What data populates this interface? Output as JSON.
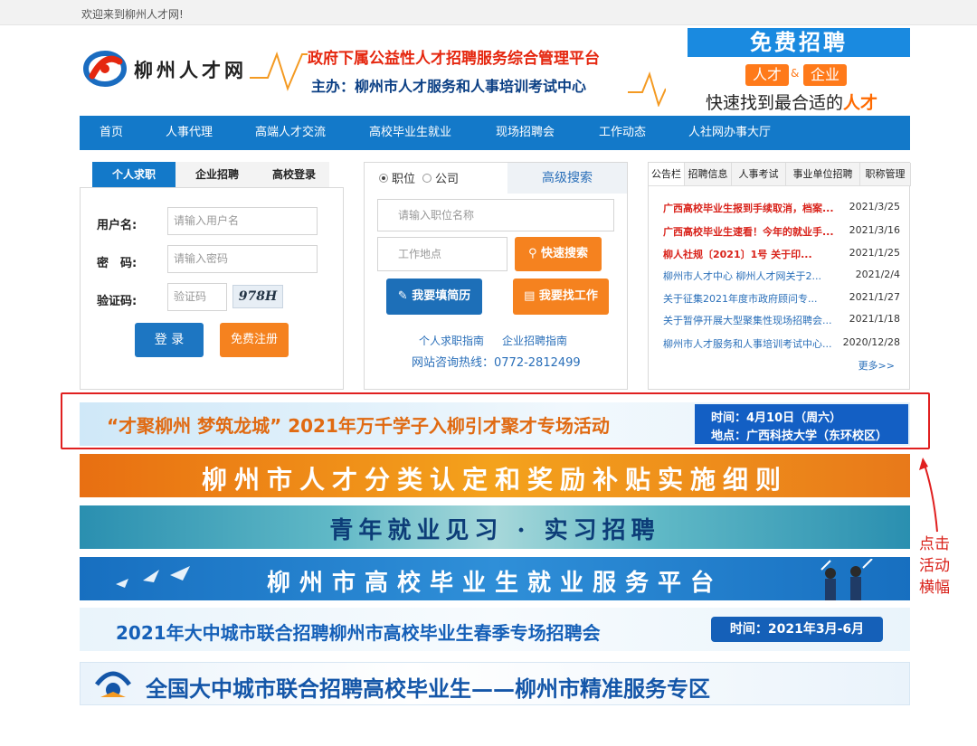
{
  "topbar": {
    "welcome": "欢迎来到柳州人才网!"
  },
  "header": {
    "logo_text": "柳州人才网",
    "slogan_line1": "政府下属公益性人才招聘服务综合管理平台",
    "slogan_line2": "主办：柳州市人才服务和人事培训考试中心",
    "promo_title": "免费招聘",
    "promo_talent": "人才",
    "promo_amp": "&",
    "promo_company": "企业",
    "promo_fast": "快速找到最合适的",
    "promo_fast_highlight": "人才"
  },
  "nav": [
    "首页",
    "人事代理",
    "高端人才交流",
    "高校毕业生就业",
    "现场招聘会",
    "工作动态",
    "人社网办事大厅"
  ],
  "login": {
    "tabs": [
      "个人求职",
      "企业招聘",
      "高校登录"
    ],
    "username_label": "用户名:",
    "username_placeholder": "请输入用户名",
    "password_label": "密　码:",
    "password_placeholder": "请输入密码",
    "captcha_label": "验证码:",
    "captcha_placeholder": "验证码",
    "captcha_text": "978H",
    "login_button": "登 录",
    "register_button": "免费注册"
  },
  "search": {
    "radio_job": "职位",
    "radio_company": "公司",
    "advanced": "高级搜索",
    "keyword_placeholder": "请输入职位名称",
    "location_placeholder": "工作地点",
    "search_button": "快速搜索",
    "resume_button": "我要填简历",
    "findjob_button": "我要找工作",
    "guide_personal": "个人求职指南",
    "guide_company": "企业招聘指南",
    "hotline": "网站咨询热线：0772-2812499"
  },
  "notice": {
    "tabs": [
      "公告栏",
      "招聘信息",
      "人事考试",
      "事业单位招聘",
      "职称管理"
    ],
    "items": [
      {
        "title": "广西高校毕业生报到手续取消，档案...",
        "date": "2021/3/25",
        "style": "hot"
      },
      {
        "title": "广西高校毕业生速看！今年的就业手...",
        "date": "2021/3/16",
        "style": "hot"
      },
      {
        "title": "柳人社规〔2021〕1号 关于印...",
        "date": "2021/1/25",
        "style": "hot"
      },
      {
        "title": "柳州市人才中心 柳州人才网关于2...",
        "date": "2021/2/4",
        "style": "blue"
      },
      {
        "title": "关于征集2021年度市政府顾问专...",
        "date": "2021/1/27",
        "style": "blue"
      },
      {
        "title": "关于暂停开展大型聚集性现场招聘会...",
        "date": "2021/1/18",
        "style": "blue"
      },
      {
        "title": "柳州市人才服务和人事培训考试中心...",
        "date": "2020/12/28",
        "style": "blue"
      }
    ],
    "more": "更多>>"
  },
  "banners": {
    "b1_main": "“才聚柳州 梦筑龙城” 2021年万千学子入柳引才聚才专场活动",
    "b1_time": "时间：4月10日（周六）",
    "b1_place": "地点：广西科技大学（东环校区）",
    "b2": "柳州市人才分类认定和奖励补贴实施细则",
    "b3": "青年就业见习 · 实习招聘",
    "b4": "柳州市高校毕业生就业服务平台",
    "b5": "2021年大中城市联合招聘柳州市高校毕业生春季专场招聘会",
    "b5_time": "时间：2021年3月-6月",
    "b6": "全国大中城市联合招聘高校毕业生——柳州市精准服务专区"
  },
  "annotation": {
    "text": "点击活动横幅"
  },
  "colors": {
    "nav_blue": "#1379c9",
    "accent_orange": "#ff7a1a",
    "hot_red": "#d9231b"
  }
}
